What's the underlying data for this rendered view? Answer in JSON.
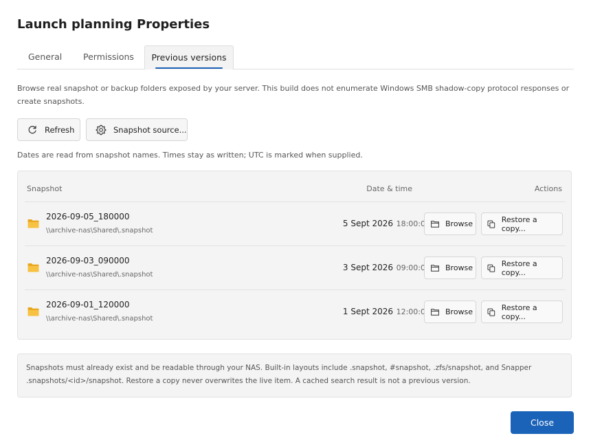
{
  "dialog": {
    "title": "Launch planning Properties",
    "tabs": [
      {
        "label": "General"
      },
      {
        "label": "Permissions"
      },
      {
        "label": "Previous versions"
      }
    ],
    "active_tab": "Previous versions"
  },
  "previous_versions": {
    "description": "Browse real snapshot or backup folders exposed by your server. This build does not enumerate Windows SMB shadow-copy protocol responses or create snapshots.",
    "toolbar": {
      "refresh_label": "Refresh",
      "snapshot_source_label": "Snapshot source..."
    },
    "dates_note": "Dates are read from snapshot names. Times stay as written; UTC is marked when supplied.",
    "table": {
      "columns": {
        "snapshot": "Snapshot",
        "date_time": "Date & time",
        "actions": "Actions"
      },
      "rows": [
        {
          "name": "2026-09-05_180000",
          "path": "\\\\archive-nas\\Shared\\.snapshot",
          "date": "5 Sept 2026",
          "time": "18:00:00",
          "browse_label": "Browse",
          "restore_label": "Restore a copy..."
        },
        {
          "name": "2026-09-03_090000",
          "path": "\\\\archive-nas\\Shared\\.snapshot",
          "date": "3 Sept 2026",
          "time": "09:00:00",
          "browse_label": "Browse",
          "restore_label": "Restore a copy..."
        },
        {
          "name": "2026-09-01_120000",
          "path": "\\\\archive-nas\\Shared\\.snapshot",
          "date": "1 Sept 2026",
          "time": "12:00:00",
          "browse_label": "Browse",
          "restore_label": "Restore a copy..."
        }
      ]
    },
    "footnote": "Snapshots must already exist and be readable through your NAS. Built-in layouts include .snapshot, #snapshot, .zfs/snapshot, and Snapper .snapshots/<id>/snapshot. Restore a copy never overwrites the live item. A cached search result is not a previous version."
  },
  "footer": {
    "close_label": "Close"
  },
  "colors": {
    "accent": "#1b63b8",
    "folder": "#f5b82e",
    "panel_bg": "#f4f4f4"
  },
  "icons": {
    "refresh": "refresh-icon",
    "settings": "gear-icon",
    "folder": "folder-icon",
    "browse": "folder-outline-icon",
    "restore": "copy-icon"
  }
}
